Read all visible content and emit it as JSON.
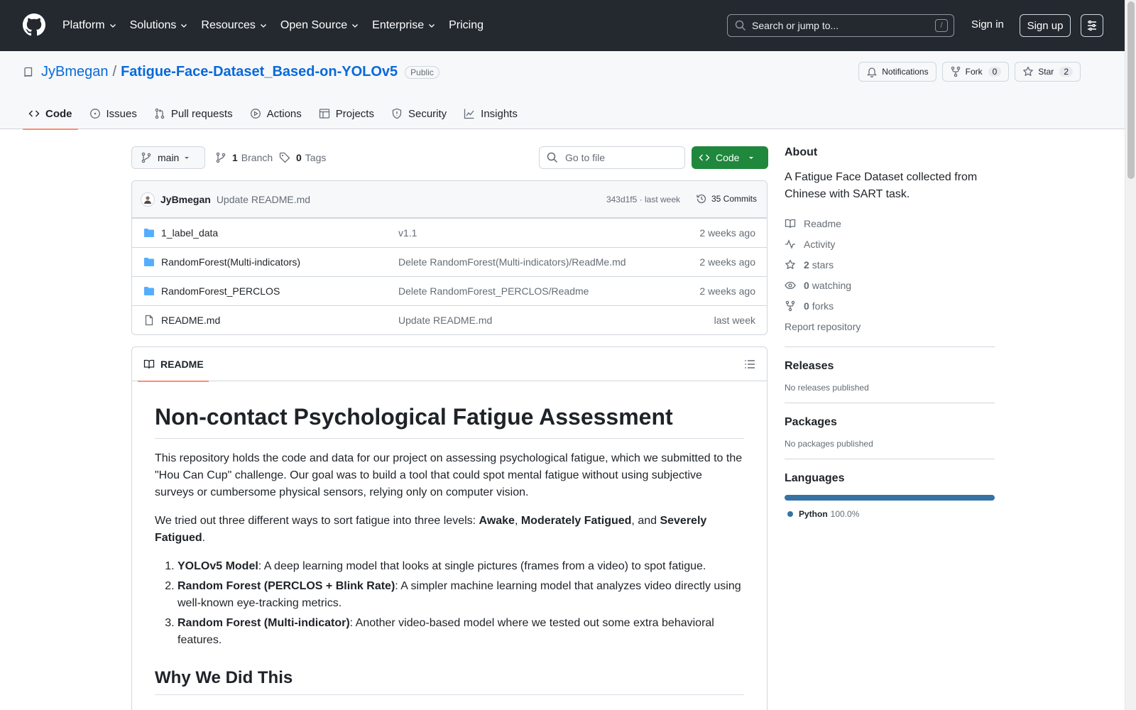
{
  "topnav": {
    "items": [
      "Platform",
      "Solutions",
      "Resources",
      "Open Source",
      "Enterprise",
      "Pricing"
    ],
    "search_placeholder": "Search or jump to...",
    "search_shortcut": "/",
    "signin": "Sign in",
    "signup": "Sign up"
  },
  "repo": {
    "owner": "JyBmegan",
    "separator": "/",
    "name": "Fatigue-Face-Dataset_Based-on-YOLOv5",
    "visibility": "Public",
    "actions": {
      "notifications": "Notifications",
      "fork": "Fork",
      "fork_count": "0",
      "star": "Star",
      "star_count": "2"
    },
    "tabs": [
      "Code",
      "Issues",
      "Pull requests",
      "Actions",
      "Projects",
      "Security",
      "Insights"
    ]
  },
  "toolbar": {
    "branch": "main",
    "branch_count": "1",
    "branch_label": "Branch",
    "tag_count": "0",
    "tag_label": "Tags",
    "goto_placeholder": "Go to file",
    "code_button": "Code"
  },
  "commit": {
    "author": "JyBmegan",
    "message": "Update README.md",
    "hash_time": "343d1f5 · last week",
    "commits_label": "35 Commits"
  },
  "files": [
    {
      "name": "1_label_data",
      "message": "v1.1",
      "age": "2 weeks ago",
      "type": "folder"
    },
    {
      "name": "RandomForest(Multi-indicators)",
      "message": "Delete RandomForest(Multi-indicators)/ReadMe.md",
      "age": "2 weeks ago",
      "type": "folder"
    },
    {
      "name": "RandomForest_PERCLOS",
      "message": "Delete RandomForest_PERCLOS/Readme",
      "age": "2 weeks ago",
      "type": "folder"
    },
    {
      "name": "README.md",
      "message": "Update README.md",
      "age": "last week",
      "type": "file"
    }
  ],
  "readme": {
    "tab_label": "README",
    "h1": "Non-contact Psychological Fatigue Assessment",
    "p1": "This repository holds the code and data for our project on assessing psychological fatigue, which we submitted to the \"Hou Can Cup\" challenge. Our goal was to build a tool that could spot mental fatigue without using subjective surveys or cumbersome physical sensors, relying only on computer vision.",
    "p2_start": "We tried out three different ways to sort fatigue into three levels: ",
    "p2_b1": "Awake",
    "p2_c1": ", ",
    "p2_b2": "Moderately Fatigued",
    "p2_c2": ", and ",
    "p2_b3": "Severely Fatigued",
    "p2_end": ".",
    "list": [
      {
        "bold": "YOLOv5 Model",
        "text": ": A deep learning model that looks at single pictures (frames from a video) to spot fatigue."
      },
      {
        "bold": "Random Forest (PERCLOS + Blink Rate)",
        "text": ": A simpler machine learning model that analyzes video directly using well-known eye-tracking metrics."
      },
      {
        "bold": "Random Forest (Multi-indicator)",
        "text": ": Another video-based model where we tested out some extra behavioral features."
      }
    ],
    "h2": "Why We Did This"
  },
  "sidebar": {
    "about_title": "About",
    "about_desc": "A Fatigue Face Dataset collected from Chinese with SART task.",
    "readme": "Readme",
    "activity": "Activity",
    "stars_count": "2",
    "stars_label": "stars",
    "watching_count": "0",
    "watching_label": "watching",
    "forks_count": "0",
    "forks_label": "forks",
    "report": "Report repository",
    "releases_title": "Releases",
    "releases_text": "No releases published",
    "packages_title": "Packages",
    "packages_text": "No packages published",
    "languages_title": "Languages",
    "language": "Python",
    "language_pct": "100.0%",
    "language_color": "#3572a5"
  }
}
